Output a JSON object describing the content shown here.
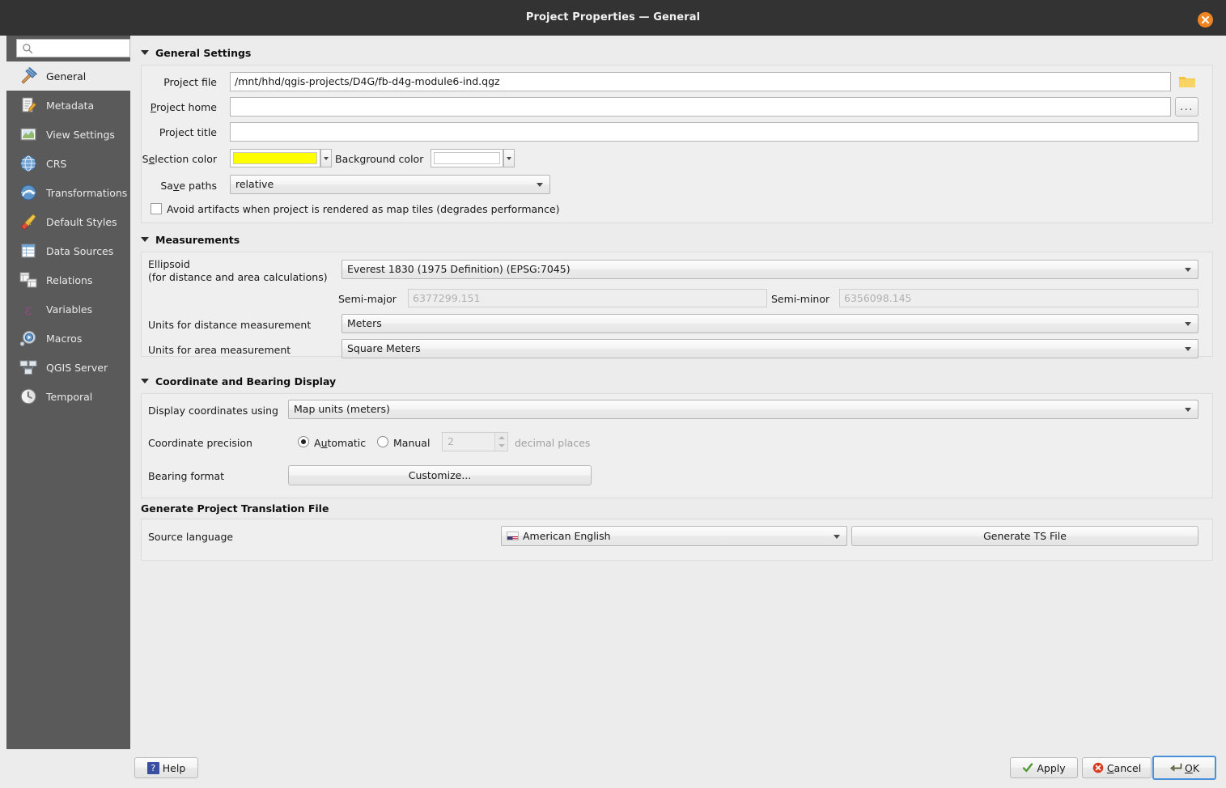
{
  "window": {
    "title": "Project Properties — General",
    "close_icon": "close-icon"
  },
  "sidebar": {
    "search": {
      "placeholder": "",
      "value": "",
      "icon": "search-icon"
    },
    "items": [
      {
        "label": "General",
        "icon": "hammer-icon",
        "selected": true
      },
      {
        "label": "Metadata",
        "icon": "document-edit-icon",
        "selected": false
      },
      {
        "label": "View Settings",
        "icon": "map-view-icon",
        "selected": false
      },
      {
        "label": "CRS",
        "icon": "globe-icon",
        "selected": false
      },
      {
        "label": "Transformations",
        "icon": "globe-arrow-icon",
        "selected": false
      },
      {
        "label": "Default Styles",
        "icon": "paintbrush-icon",
        "selected": false
      },
      {
        "label": "Data Sources",
        "icon": "table-icon",
        "selected": false
      },
      {
        "label": "Relations",
        "icon": "relations-icon",
        "selected": false
      },
      {
        "label": "Variables",
        "icon": "epsilon-icon",
        "selected": false
      },
      {
        "label": "Macros",
        "icon": "gear-play-icon",
        "selected": false
      },
      {
        "label": "QGIS Server",
        "icon": "server-icon",
        "selected": false
      },
      {
        "label": "Temporal",
        "icon": "clock-icon",
        "selected": false
      }
    ]
  },
  "general_settings": {
    "title": "General Settings",
    "project_file": {
      "label": "Project file",
      "value": "/mnt/hhd/qgis-projects/D4G/fb-d4g-module6-ind.qgz",
      "browse_icon": "folder-icon"
    },
    "project_home": {
      "label": "Project home",
      "label_accel": "P",
      "value": "",
      "browse_label": "..."
    },
    "project_title": {
      "label": "Project title",
      "value": ""
    },
    "selection_color": {
      "label": "Selection color",
      "label_accel": "e",
      "value": "#ffff00"
    },
    "background_color": {
      "label": "Background color",
      "label_accel": "g",
      "value": "#ffffff"
    },
    "save_paths": {
      "label": "Save paths",
      "label_accel": "v",
      "value": "relative"
    },
    "avoid_artifacts": {
      "label": "Avoid artifacts when project is rendered as map tiles (degrades performance)",
      "checked": false
    }
  },
  "measurements": {
    "title": "Measurements",
    "ellipsoid": {
      "label_line1": "Ellipsoid",
      "label_line2": "(for distance and area calculations)",
      "value": "Everest 1830 (1975 Definition) (EPSG:7045)"
    },
    "semi_major": {
      "label": "Semi-major",
      "value": "6377299.151",
      "disabled": true
    },
    "semi_minor": {
      "label": "Semi-minor",
      "value": "6356098.145",
      "disabled": true
    },
    "distance_units": {
      "label": "Units for distance measurement",
      "value": "Meters"
    },
    "area_units": {
      "label": "Units for area measurement",
      "value": "Square Meters"
    }
  },
  "coordinate_display": {
    "title": "Coordinate and Bearing Display",
    "display_coordinates": {
      "label": "Display coordinates using",
      "value": "Map units (meters)"
    },
    "coordinate_precision": {
      "label": "Coordinate precision",
      "automatic_label": "Automatic",
      "automatic_accel": "u",
      "automatic_selected": true,
      "manual_label": "Manual",
      "manual_selected": false,
      "decimal_value": "2",
      "decimal_suffix": "decimal places"
    },
    "bearing_format": {
      "label": "Bearing format",
      "button_label": "Customize..."
    }
  },
  "translation": {
    "title": "Generate Project Translation File",
    "source_language": {
      "label": "Source language",
      "value": "American English",
      "flag": "us-flag-icon"
    },
    "generate_button": "Generate TS File"
  },
  "footer": {
    "help": "Help",
    "apply": "Apply",
    "cancel": "Cancel",
    "cancel_accel": "C",
    "ok": "OK",
    "ok_accel": "O"
  },
  "colors": {
    "titlebar": "#333333",
    "sidebar": "#5a5a5a",
    "panel": "#efefef",
    "dialog": "#ececec",
    "close_button": "#ef8420",
    "focus_ring": "#4a90d9"
  }
}
